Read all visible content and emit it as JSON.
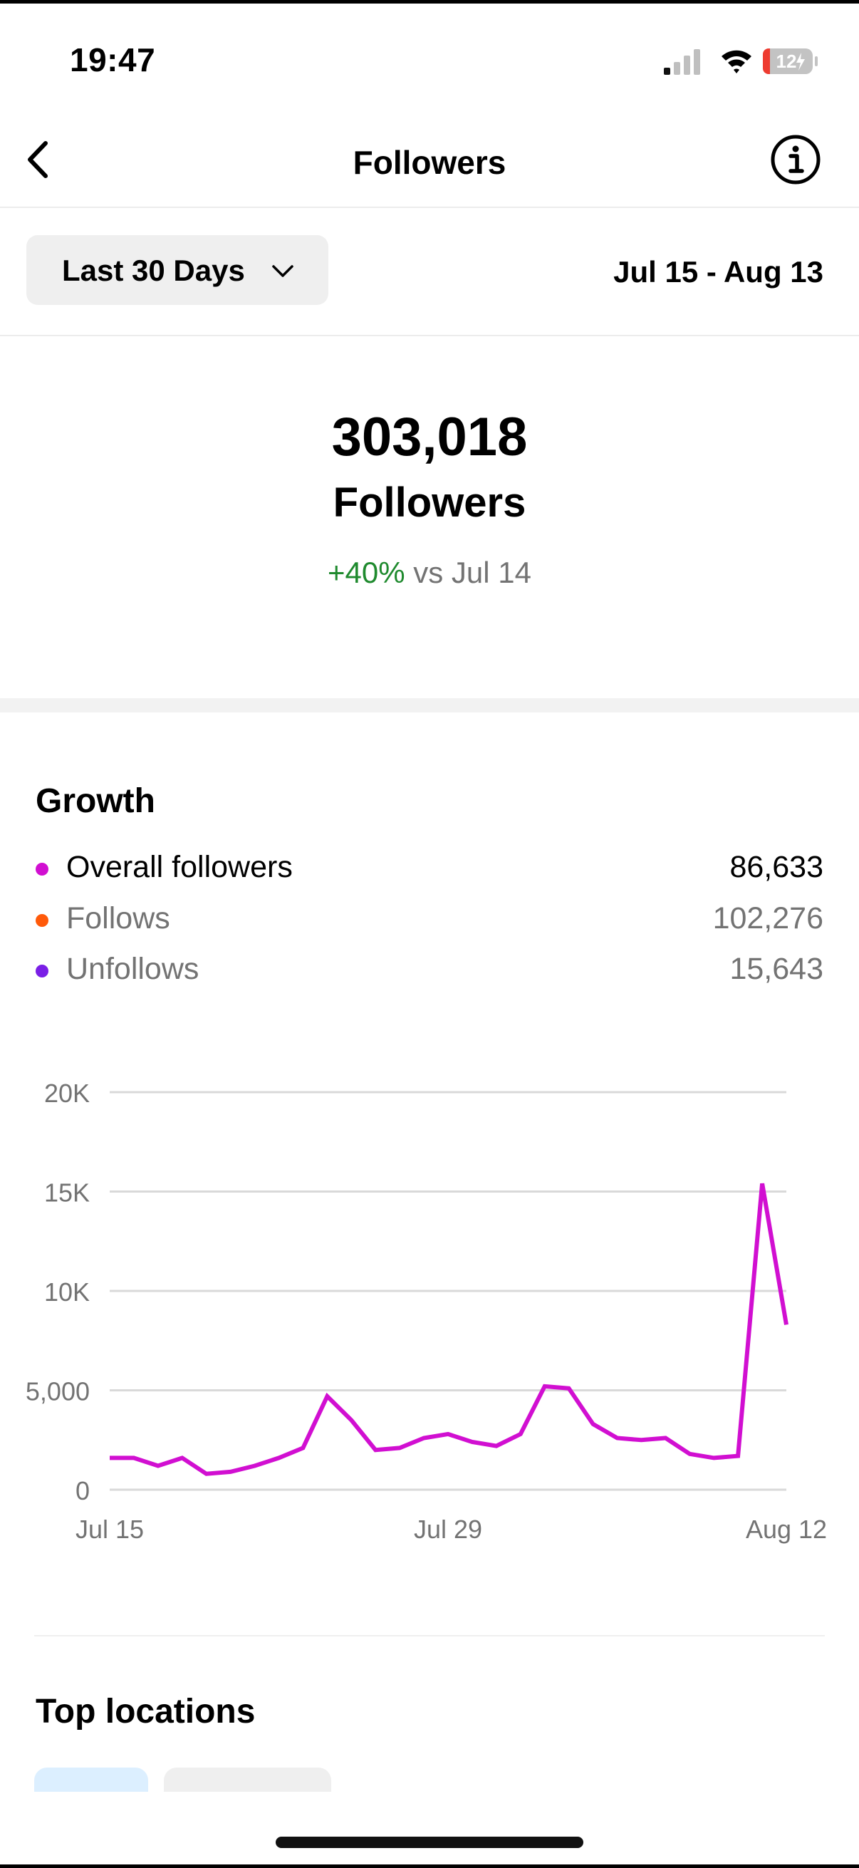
{
  "status_bar": {
    "time": "19:47",
    "battery_level": "12"
  },
  "nav": {
    "title": "Followers"
  },
  "filter": {
    "range_label": "Last 30 Days",
    "date_range": "Jul 15 - Aug 13"
  },
  "summary": {
    "count": "303,018",
    "label": "Followers",
    "change": "+40%",
    "compare_text": "vs Jul 14"
  },
  "growth": {
    "title": "Growth",
    "legend": [
      {
        "label": "Overall followers",
        "value": "86,633",
        "color": "#d10fd1"
      },
      {
        "label": "Follows",
        "value": "102,276",
        "color": "#ff5a0a"
      },
      {
        "label": "Unfollows",
        "value": "15,643",
        "color": "#7a1fe6"
      }
    ]
  },
  "chart_data": {
    "type": "line",
    "title": "",
    "xlabel": "",
    "ylabel": "",
    "ylim": [
      0,
      20000
    ],
    "yticks": [
      0,
      5000,
      10000,
      15000,
      20000
    ],
    "ytick_labels": [
      "0",
      "5,000",
      "10K",
      "15K",
      "20K"
    ],
    "xtick_labels": [
      "Jul 15",
      "Jul 29",
      "Aug 12"
    ],
    "x": [
      "Jul 15",
      "Jul 16",
      "Jul 17",
      "Jul 18",
      "Jul 19",
      "Jul 20",
      "Jul 21",
      "Jul 22",
      "Jul 23",
      "Jul 24",
      "Jul 25",
      "Jul 26",
      "Jul 27",
      "Jul 28",
      "Jul 29",
      "Jul 30",
      "Jul 31",
      "Aug 1",
      "Aug 2",
      "Aug 3",
      "Aug 4",
      "Aug 5",
      "Aug 6",
      "Aug 7",
      "Aug 8",
      "Aug 9",
      "Aug 10",
      "Aug 11",
      "Aug 12",
      "Aug 13"
    ],
    "grid": true,
    "series": [
      {
        "name": "Overall followers",
        "color": "#d10fd1",
        "values": [
          1600,
          1600,
          1200,
          1600,
          800,
          900,
          1200,
          1600,
          2100,
          4700,
          3500,
          2000,
          2100,
          2600,
          2800,
          2400,
          2200,
          2800,
          5200,
          5100,
          3300,
          2600,
          2500,
          2600,
          1800,
          1600,
          1700,
          15400,
          8300
        ]
      }
    ]
  },
  "locations": {
    "title": "Top locations"
  }
}
